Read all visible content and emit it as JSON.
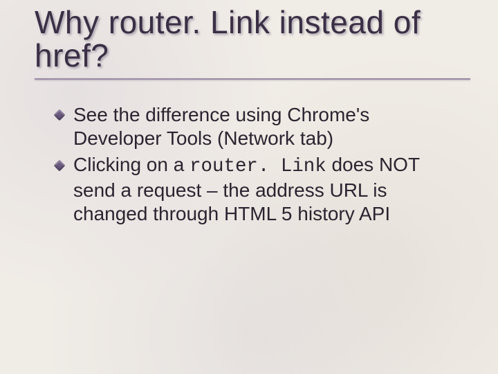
{
  "title": "Why router. Link instead of href?",
  "bullets": [
    {
      "pre": "See the difference using Chrome's Developer Tools (Network tab)",
      "code": "",
      "post": ""
    },
    {
      "pre": "Clicking on a ",
      "code": "router. Link",
      "post": " does NOT send a request – the address URL is changed through HTML 5 history API"
    }
  ]
}
